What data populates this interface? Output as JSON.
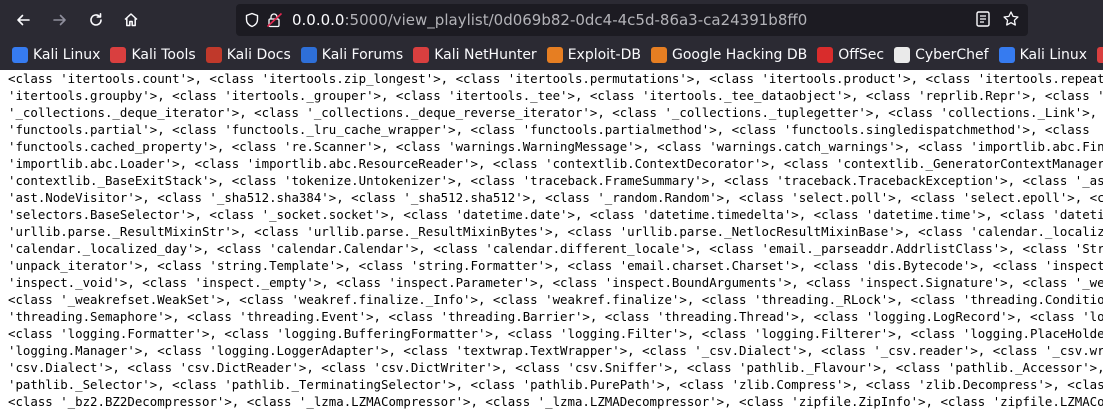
{
  "browser": {
    "url_host": "0.0.0.0",
    "url_rest": ":5000/view_playlist/0d069b82-0dc4-4c5d-86a3-ca24391b8ff0"
  },
  "bookmarks": [
    {
      "label": "Kali Linux",
      "icon": "kali-dragon-icon",
      "color": "#367bf0"
    },
    {
      "label": "Kali Tools",
      "icon": "kali-tools-icon",
      "color": "#d93f3f"
    },
    {
      "label": "Kali Docs",
      "icon": "kali-docs-icon",
      "color": "#c0392b"
    },
    {
      "label": "Kali Forums",
      "icon": "kali-forums-icon",
      "color": "#2e6fd8"
    },
    {
      "label": "Kali NetHunter",
      "icon": "nethunter-icon",
      "color": "#d93f3f"
    },
    {
      "label": "Exploit-DB",
      "icon": "exploit-db-icon",
      "color": "#e67e22"
    },
    {
      "label": "Google Hacking DB",
      "icon": "ghdb-icon",
      "color": "#e67e22"
    },
    {
      "label": "OffSec",
      "icon": "offsec-icon",
      "color": "#d92c2c"
    },
    {
      "label": "CyberChef",
      "icon": "cyberchef-icon",
      "color": "#eaeaea"
    },
    {
      "label": "Kali Linux",
      "icon": "kali-dragon-icon",
      "color": "#367bf0"
    },
    {
      "label": "Kali",
      "icon": "kali-tools-icon",
      "color": "#d93f3f"
    }
  ],
  "content_lines": [
    "<class 'itertools.count'>, <class 'itertools.zip_longest'>, <class 'itertools.permutations'>, <class 'itertools.product'>, <class 'itertools.repeat'>, <",
    "'itertools.groupby'>, <class 'itertools._grouper'>, <class 'itertools._tee'>, <class 'itertools._tee_dataobject'>, <class 'reprlib.Repr'>, <class 'col",
    "'_collections._deque_iterator'>, <class '_collections._deque_reverse_iterator'>, <class '_collections._tuplegetter'>, <class 'collections._Link'>, <cla",
    "'functools.partial'>, <class 'functools._lru_cache_wrapper'>, <class 'functools.partialmethod'>, <class 'functools.singledispatchmethod'>, <class",
    "'functools.cached_property'>, <class 're.Scanner'>, <class 'warnings.WarningMessage'>, <class 'warnings.catch_warnings'>, <class 'importlib.abc.Finder",
    "'importlib.abc.Loader'>, <class 'importlib.abc.ResourceReader'>, <class 'contextlib.ContextDecorator'>, <class 'contextlib._GeneratorContextManagerBase",
    "'contextlib._BaseExitStack'>, <class 'tokenize.Untokenizer'>, <class 'traceback.FrameSummary'>, <class 'traceback.TracebackException'>, <class '_ast.A",
    "'ast.NodeVisitor'>, <class '_sha512.sha384'>, <class '_sha512.sha512'>, <class '_random.Random'>, <class 'select.poll'>, <class 'select.epoll'>, <cla",
    "'selectors.BaseSelector'>, <class '_socket.socket'>, <class 'datetime.date'>, <class 'datetime.timedelta'>, <class 'datetime.time'>, <class 'datetime",
    "'urllib.parse._ResultMixinStr'>, <class 'urllib.parse._ResultMixinBytes'>, <class 'urllib.parse._NetlocResultMixinBase'>, <class 'calendar._localized_",
    "'calendar._localized_day'>, <class 'calendar.Calendar'>, <class 'calendar.different_locale'>, <class 'email._parseaddr.AddrlistClass'>, <class 'Struct",
    "'unpack_iterator'>, <class 'string.Template'>, <class 'string.Formatter'>, <class 'email.charset.Charset'>, <class 'dis.Bytecode'>, <class 'inspect.Bl",
    "'inspect._void'>, <class 'inspect._empty'>, <class 'inspect.Parameter'>, <class 'inspect.BoundArguments'>, <class 'inspect.Signature'>, <class '_weakr",
    "<class '_weakrefset.WeakSet'>, <class 'weakref.finalize._Info'>, <class 'weakref.finalize'>, <class 'threading._RLock'>, <class 'threading.Condition'>,",
    "'threading.Semaphore'>, <class 'threading.Event'>, <class 'threading.Barrier'>, <class 'threading.Thread'>, <class 'logging.LogRecord'>, <class 'loggi",
    "<class 'logging.Formatter'>, <class 'logging.BufferingFormatter'>, <class 'logging.Filter'>, <class 'logging.Filterer'>, <class 'logging.PlaceHolder'>,",
    "'logging.Manager'>, <class 'logging.LoggerAdapter'>, <class 'textwrap.TextWrapper'>, <class '_csv.Dialect'>, <class '_csv.reader'>, <class '_csv.write",
    "'csv.Dialect'>, <class 'csv.DictReader'>, <class 'csv.DictWriter'>, <class 'csv.Sniffer'>, <class 'pathlib._Flavour'>, <class 'pathlib._Accessor'>, <c",
    "'pathlib._Selector'>, <class 'pathlib._TerminatingSelector'>, <class 'pathlib.PurePath'>, <class 'zlib.Compress'>, <class 'zlib.Decompress'>, <class",
    "<class '_bz2.BZ2Decompressor'>, <class '_lzma.LZMACompressor'>, <class '_lzma.LZMADecompressor'>, <class 'zipfile.ZipInfo'>, <class 'zipfile.LZMACompr"
  ]
}
